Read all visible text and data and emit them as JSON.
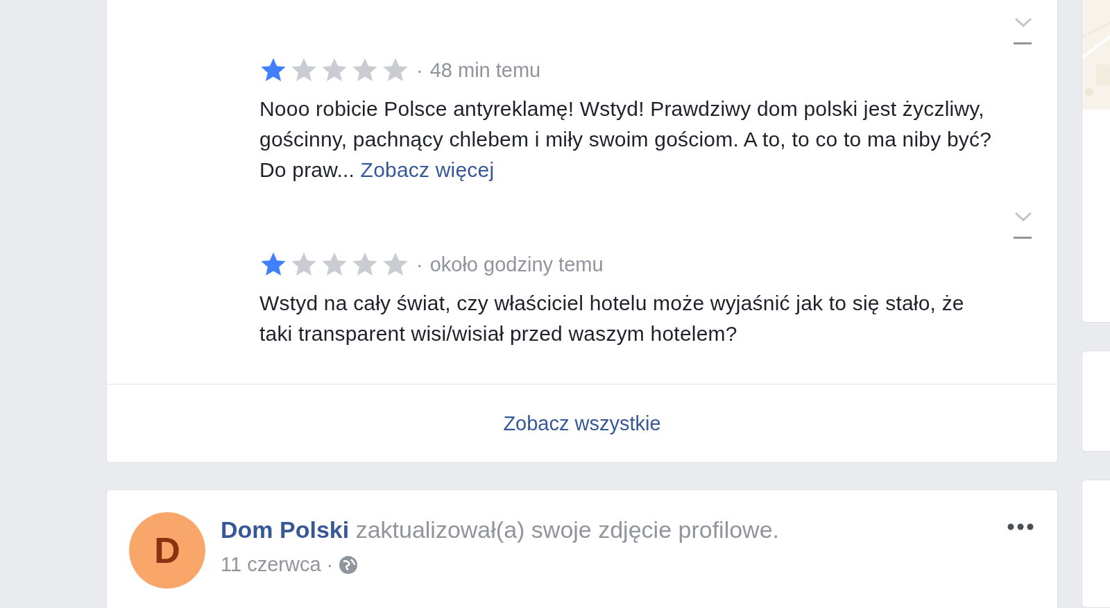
{
  "reviews_card": {
    "separator": "·",
    "reviews": [
      {
        "stars": 1,
        "time": "48 min temu",
        "text": "Nooo robicie Polsce antyreklamę! Wstyd! Prawdziwy dom polski jest życzliwy, gościnny, pachnący chlebem i miły swoim gościom. A to, to co to ma niby być? Do praw...",
        "more_link": "Zobacz więcej"
      },
      {
        "stars": 1,
        "time": "około godziny temu",
        "text": "Wstyd na cały świat, czy właściciel hotelu może wyjaśnić jak to się stało, że taki transparent wisi/wisiał przed waszym hotelem?"
      }
    ],
    "see_all": "Zobacz wszystkie"
  },
  "post": {
    "avatar_letter": "D",
    "author": "Dom Polski",
    "action": "zaktualizował(a) swoje zdjęcie profilowe.",
    "date": "11 czerwca",
    "separator": "·"
  },
  "side_cards": [
    {
      "kind": "map"
    },
    {
      "kind": "plain"
    },
    {
      "kind": "plain"
    }
  ]
}
